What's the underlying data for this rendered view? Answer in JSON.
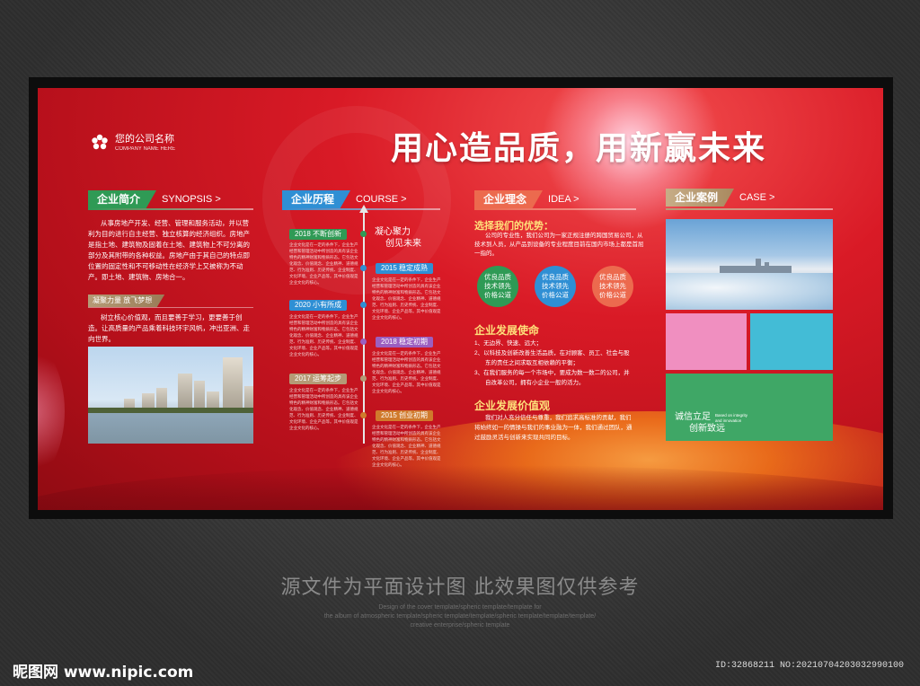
{
  "company": {
    "name": "您的公司名称",
    "name_en": "COMPANY NAME HERE"
  },
  "slogan": "用心造品质，用新赢未来",
  "sections": {
    "intro": {
      "tag": "企业简介",
      "en": "SYNOPSIS >"
    },
    "course": {
      "tag": "企业历程",
      "en": "COURSE >"
    },
    "idea": {
      "tag": "企业理念",
      "en": "IDEA >"
    },
    "case": {
      "tag": "企业案例",
      "en": "CASE >"
    }
  },
  "intro": {
    "body": "从事房地产开发、经营、管理和服务活动，并以营利为目的进行自主经营、独立核算的经济组织。房地产是指土地、建筑物及固着在土地、建筑物上不可分离的部分及其附带的各种权益。房地产由于其自己的特点即位置的固定性和不可移动性在经济学上又被称为不动产。即土地、建筑物、房地合一。",
    "sub_tag": "凝聚力量 放飞梦想",
    "sub_body": "树立核心价值观，而且要善于学习，更要善于创造。让高质量的产品乘着科技环宇风帆，冲出亚洲、走向世界。"
  },
  "course": {
    "spirit": [
      "凝心聚力",
      "创见未来"
    ],
    "items": [
      {
        "label": "2018 不断创新",
        "text": "企业文化是在一定的条件下，企业生产经营和管理活动中所创造的具有该企业特色的精神财富和物质形态。它包括文化观念、价值观念、企业精神、道德规范、行为准则、历史传统、企业制度、文化环境、企业产品等。其中价值观是企业文化的核心。"
      },
      {
        "label": "2015 稳定成熟",
        "text": "企业文化是在一定的条件下，企业生产经营和管理活动中所创造的具有该企业特色的精神财富和物质形态。它包括文化观念、价值观念、企业精神、道德规范、行为准则、历史传统、企业制度、文化环境、企业产品等。其中价值观是企业文化的核心。"
      },
      {
        "label": "2020 小有所成",
        "text": "企业文化是在一定的条件下，企业生产经营和管理活动中所创造的具有该企业特色的精神财富和物质形态。它包括文化观念、价值观念、企业精神、道德规范、行为准则、历史传统、企业制度、文化环境、企业产品等。其中价值观是企业文化的核心。"
      },
      {
        "label": "2018 稳定初期",
        "text": "企业文化是在一定的条件下，企业生产经营和管理活动中所创造的具有该企业特色的精神财富和物质形态。它包括文化观念、价值观念、企业精神、道德规范、行为准则、历史传统、企业制度、文化环境、企业产品等。其中价值观是企业文化的核心。"
      },
      {
        "label": "2017 运筹起步",
        "text": "企业文化是在一定的条件下，企业生产经营和管理活动中所创造的具有该企业特色的精神财富和物质形态。它包括文化观念、价值观念、企业精神、道德规范、行为准则、历史传统、企业制度、文化环境、企业产品等。其中价值观是企业文化的核心。"
      },
      {
        "label": "2015 创业初期",
        "text": "企业文化是在一定的条件下，企业生产经营和管理活动中所创造的具有该企业特色的精神财富和物质形态。它包括文化观念、价值观念、企业精神、道德规范、行为准则、历史传统、企业制度、文化环境、企业产品等。其中价值观是企业文化的核心。"
      }
    ]
  },
  "idea": {
    "adv_title": "选择我们的优势：",
    "adv_body": "公司的专业性，我们公司为一家正规注册的跨国贸易公司，从技术到人员，从产品到设备的专业程度目前在国内市场上都是首屈一指的。",
    "circles": [
      {
        "l1": "优良品质",
        "l2": "技术领先",
        "l3": "价格公道",
        "color": "#2f9a55"
      },
      {
        "l1": "优良品质",
        "l2": "技术领先",
        "l3": "价格公道",
        "color": "#2f8fd4"
      },
      {
        "l1": "优良品质",
        "l2": "技术领先",
        "l3": "价格公道",
        "color": "#ec6a4e"
      }
    ],
    "mission_title": "企业发展使命",
    "mission_items": [
      "1、无边界、快速、远大；",
      "2、以科技及创新改善生活品质，在对顾客、员工、社会与股",
      "东的责任之间求取互相依赖的平衡；",
      "3、在我们服务的每一个市场中，要成为数一数二的公司，并",
      "自改革公司，拥有小企业一般的活力。"
    ],
    "values_title": "企业发展价值观",
    "values_body": "我们对人充分信任与尊重，我们追求高标准的贡献，我们将始终如一的情操与我们的事业融为一体，我们通过团队，通过鼓励灵活与创新来实现共同的目标。"
  },
  "case": {
    "colors": {
      "pink": "#f08fc0",
      "cyan": "#43bcd6",
      "green": "#3fa766"
    },
    "motto": [
      "诚信立足",
      "创新致远"
    ],
    "motto_en": [
      "Based on integrity",
      "and innovation"
    ]
  },
  "notice": "源文件为平面设计图 此效果图仅供参考",
  "fine_print": [
    "Design of the cover template/spheric template/template for",
    "the album of atmospheric template/spheric template/template/spheric template/template/template/",
    "creative enterprise/spheric template"
  ],
  "watermark": "昵图网 www.nipic.com",
  "id_text": "ID:32868211 NO:20210704203032990100"
}
